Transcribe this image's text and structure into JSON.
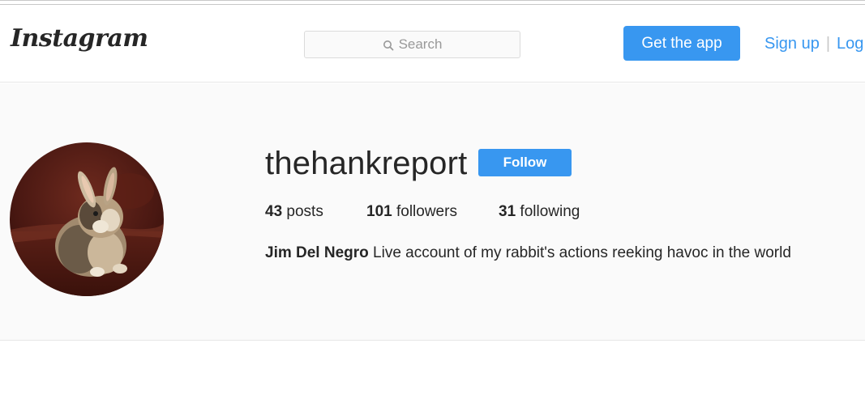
{
  "header": {
    "logo_text": "Instagram",
    "search": {
      "placeholder": "Search",
      "icon": "search-icon"
    },
    "get_app_label": "Get the app",
    "sign_up_label": "Sign up",
    "separator": "|",
    "log_in_label": "Log"
  },
  "profile": {
    "username": "thehankreport",
    "follow_label": "Follow",
    "stats": {
      "posts": {
        "count": "43",
        "label": "posts"
      },
      "followers": {
        "count": "101",
        "label": "followers"
      },
      "following": {
        "count": "31",
        "label": "following"
      }
    },
    "bio": {
      "full_name": "Jim Del Negro",
      "text": "Live account of my rabbit's actions reeking havoc in the world"
    }
  },
  "colors": {
    "accent": "#3897f0",
    "text": "#262626",
    "background": "#fafafa"
  }
}
